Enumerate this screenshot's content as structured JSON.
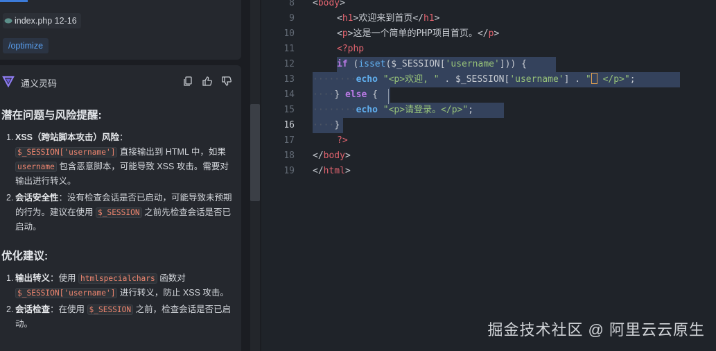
{
  "left_panel": {
    "file_chip": "index.php 12-16",
    "command_chip": "/optimize",
    "assistant_name": "通义灵码",
    "section1": {
      "title": "潜在问题与风险提醒:",
      "items": [
        {
          "num": "1.",
          "bold": "XSS（跨站脚本攻击）风险",
          "colon": "：",
          "code1": "$_SESSION['username']",
          "t1": " 直接输出到 HTML 中，如果 ",
          "code2": "username",
          "t2": " 包含恶意脚本，可能导致 XSS 攻击。需要对输出进行转义。"
        },
        {
          "num": "2.",
          "bold": "会话安全性",
          "t1": "：没有检查会话是否已启动，可能导致未预期的行为。建议在使用 ",
          "code1": "$_SESSION",
          "t2": " 之前先检查会话是否已启动。"
        }
      ]
    },
    "section2": {
      "title": "优化建议:",
      "items": [
        {
          "num": "1.",
          "bold": "输出转义",
          "t1": "：使用 ",
          "code1": "htmlspecialchars",
          "t2": " 函数对 ",
          "code2": "$_SESSION['username']",
          "t3": " 进行转义，防止 XSS 攻击。"
        },
        {
          "num": "2.",
          "bold": "会话检查",
          "t1": "：在使用 ",
          "code1": "$_SESSION",
          "t2": " 之前，检查会话是否已启动。"
        }
      ]
    }
  },
  "editor": {
    "line_numbers": [
      "8",
      "9",
      "10",
      "11",
      "12",
      "13",
      "14",
      "15",
      "16",
      "17",
      "18",
      "19"
    ],
    "active_line": "16",
    "code": {
      "l8": {
        "o": "<",
        "tag": "body",
        "c": ">"
      },
      "l9": {
        "o": "<",
        "tag": "h1",
        "c": ">",
        "text": "欢迎来到首页",
        "o2": "</",
        "tag2": "h1",
        "c2": ">"
      },
      "l10": {
        "o": "<",
        "tag": "p",
        "c": ">",
        "text": "这是一个简单的PHP项目首页。",
        "o2": "</",
        "tag2": "p",
        "c2": ">"
      },
      "l11": {
        "php_open": "<?php"
      },
      "l12": {
        "kw": "if",
        "p1": " (",
        "fn": "isset",
        "p2": "($_SESSION[",
        "str": "'username'",
        "p3": "])) {"
      },
      "l13": {
        "ws": "········",
        "kw": "echo",
        "sp": " ",
        "s1": "\"<p>欢迎, \"",
        "op": " . ",
        "var": "$_SESSION[",
        "s2": "'username'",
        "p": "]",
        "op2": " . ",
        "s3a": "\"",
        "s3b": " </p>\"",
        "end": ";"
      },
      "l14": {
        "ws": "····",
        "p": "} ",
        "kw": "else",
        "p2": " {"
      },
      "l15": {
        "ws": "········",
        "kw": "echo",
        "sp": " ",
        "s": "\"<p>请登录。</p>\"",
        "end": ";"
      },
      "l16": {
        "ws": "····",
        "p": "}"
      },
      "l17": {
        "php_close": "?>"
      },
      "l18": {
        "o": "</",
        "tag": "body",
        "c": ">"
      },
      "l19": {
        "o": "</",
        "tag": "html",
        "c": ">"
      }
    }
  },
  "watermark": "掘金技术社区 @ 阿里云云原生",
  "colors": {
    "selection": "#34425c",
    "tag": "#e2646f",
    "keyword": "#bb7ae6",
    "string": "#98c379",
    "function": "#61afef",
    "code_inline": "#f08670"
  }
}
